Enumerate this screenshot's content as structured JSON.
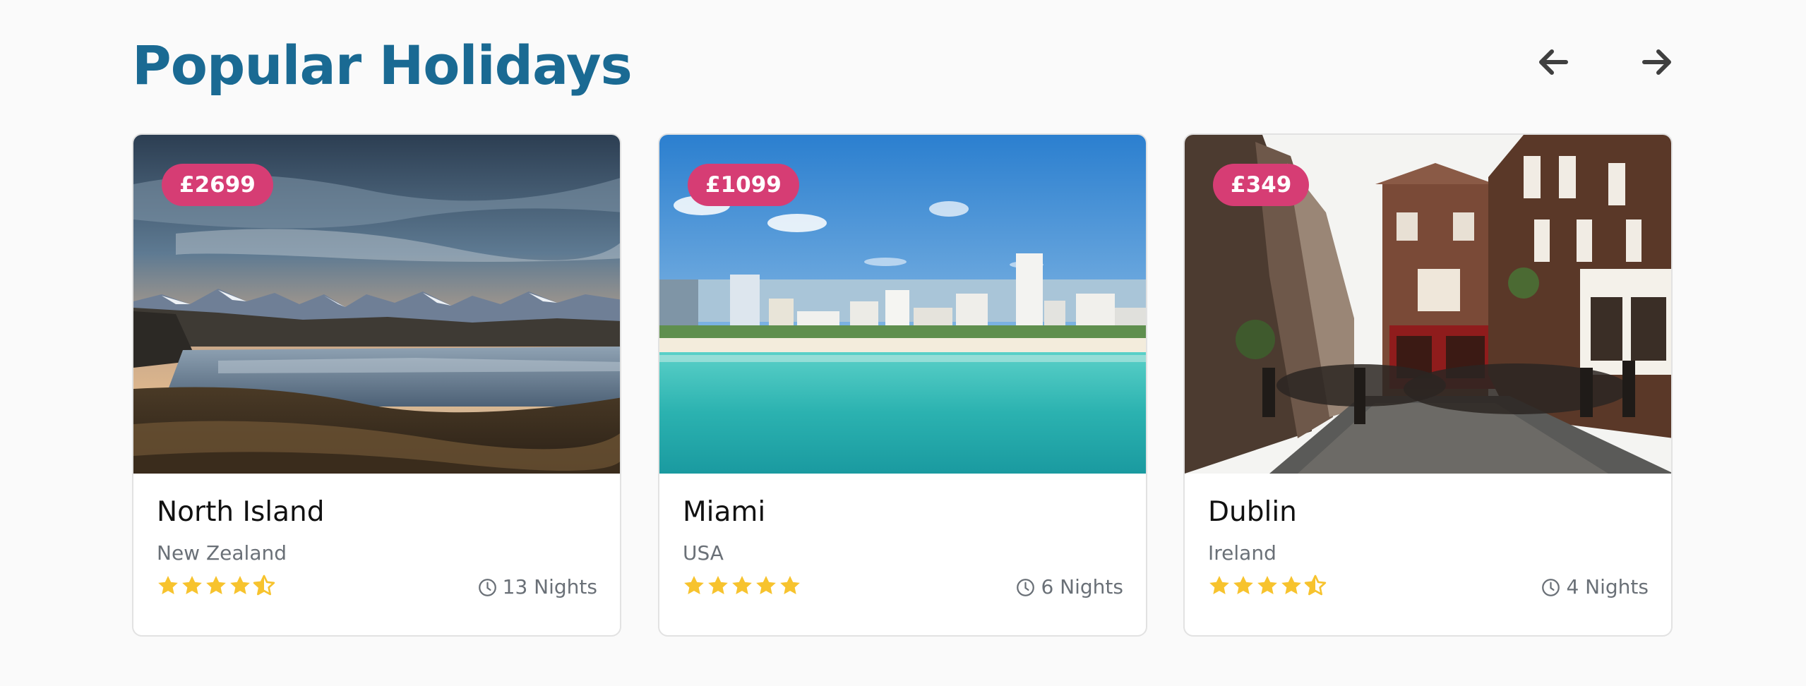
{
  "section": {
    "title": "Popular Holidays"
  },
  "nav": {
    "prev_icon": "arrow-left-icon",
    "next_icon": "arrow-right-icon"
  },
  "colors": {
    "title": "#1a6a93",
    "price_badge": "#d63d74",
    "star": "#f7c32e",
    "muted_text": "#6a7077"
  },
  "cards": [
    {
      "price": "£2699",
      "title": "North Island",
      "country": "New Zealand",
      "rating": 4.5,
      "nights": "13 Nights",
      "image": "mountain-lake-landscape-photo"
    },
    {
      "price": "£1099",
      "title": "Miami",
      "country": "USA",
      "rating": 5,
      "nights": "6 Nights",
      "image": "beach-skyline-photo"
    },
    {
      "price": "£349",
      "title": "Dublin",
      "country": "Ireland",
      "rating": 4.5,
      "nights": "4 Nights",
      "image": "cobblestone-street-pubs-photo"
    }
  ]
}
